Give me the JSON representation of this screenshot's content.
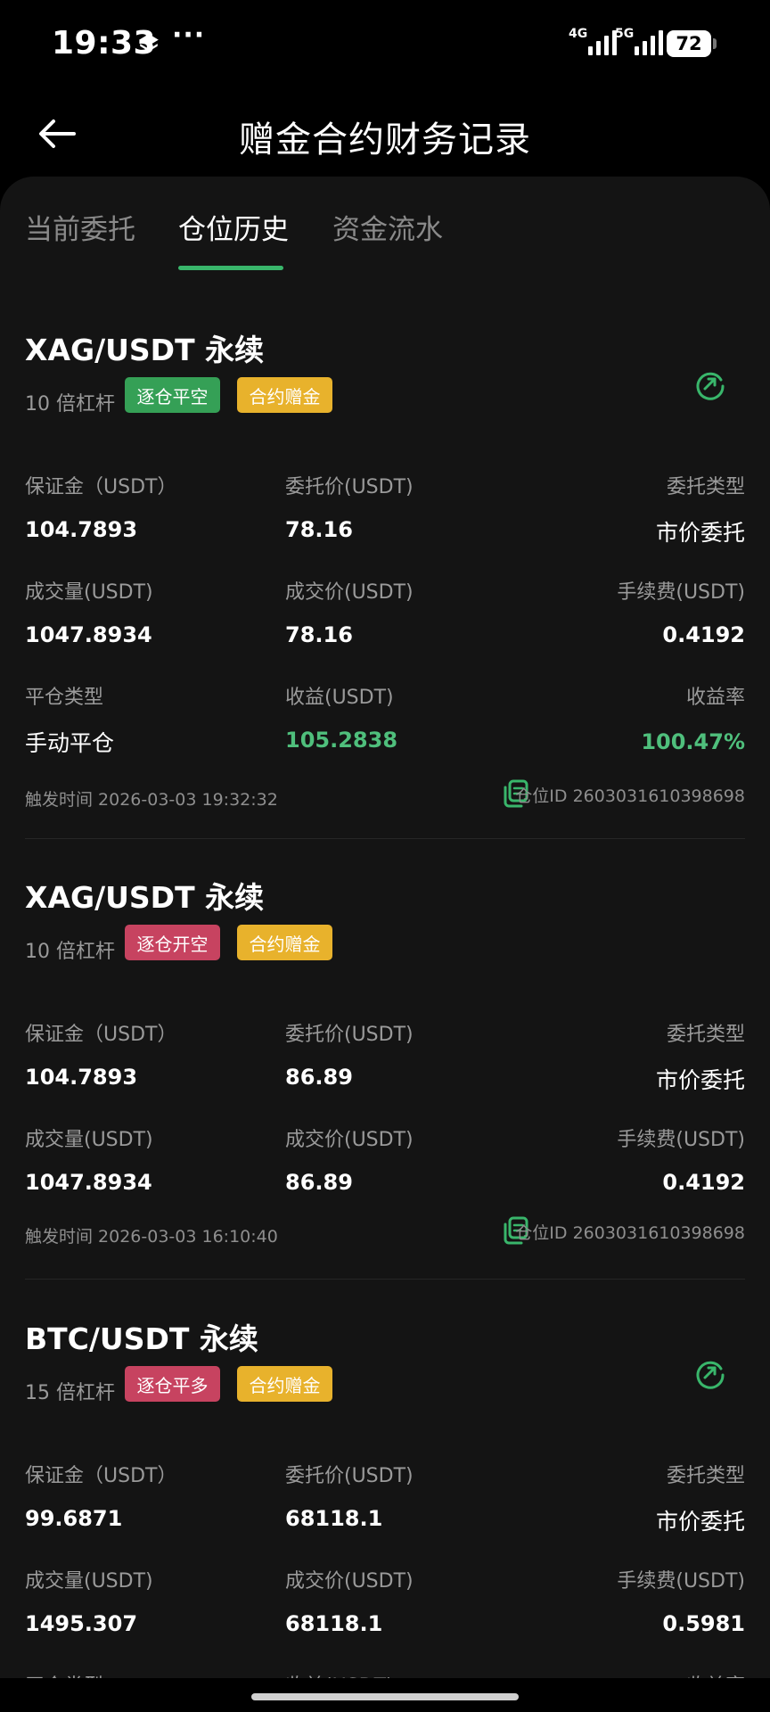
{
  "status_bar": {
    "time": "19:33",
    "dots": "···",
    "net1": "4G",
    "net2": "5G",
    "battery": "72"
  },
  "header": {
    "title": "赠金合约财务记录",
    "back_icon": "arrow-left-icon"
  },
  "tabs": [
    {
      "label": "当前委托",
      "active": false
    },
    {
      "label": "仓位历史",
      "active": true
    },
    {
      "label": "资金流水",
      "active": false
    }
  ],
  "colors": {
    "accent_green": "#39b66b",
    "tag_green": "#35a056",
    "tag_red": "#c74360",
    "tag_yellow": "#e8b22c",
    "profit_green": "#4fbf7c"
  },
  "records": [
    {
      "pair": "XAG/USDT 永续",
      "leverage": "10 倍杠杆",
      "tags": [
        {
          "label": "逐仓平空",
          "color": "green"
        },
        {
          "label": "合约赠金",
          "color": "yellow"
        }
      ],
      "fields": {
        "margin_label": "保证金（USDT）",
        "margin": "104.7893",
        "order_price_label": "委托价(USDT)",
        "order_price": "78.16",
        "order_type_label": "委托类型",
        "order_type": "市价委托",
        "volume_label": "成交量(USDT)",
        "volume": "1047.8934",
        "fill_price_label": "成交价(USDT)",
        "fill_price": "78.16",
        "fee_label": "手续费(USDT)",
        "fee": "0.4192",
        "close_type_label": "平仓类型",
        "close_type": "手动平仓",
        "pnl_label": "收益(USDT)",
        "pnl": "105.2838",
        "roi_label": "收益率",
        "roi": "100.47%"
      },
      "trigger_time": "触发时间 2026-03-03 19:32:32",
      "position_id": "仓位ID 2603031610398698"
    },
    {
      "pair": "XAG/USDT 永续",
      "leverage": "10 倍杠杆",
      "tags": [
        {
          "label": "逐仓开空",
          "color": "red"
        },
        {
          "label": "合约赠金",
          "color": "yellow"
        }
      ],
      "fields": {
        "margin_label": "保证金（USDT）",
        "margin": "104.7893",
        "order_price_label": "委托价(USDT)",
        "order_price": "86.89",
        "order_type_label": "委托类型",
        "order_type": "市价委托",
        "volume_label": "成交量(USDT)",
        "volume": "1047.8934",
        "fill_price_label": "成交价(USDT)",
        "fill_price": "86.89",
        "fee_label": "手续费(USDT)",
        "fee": "0.4192"
      },
      "trigger_time": "触发时间 2026-03-03 16:10:40",
      "position_id": "仓位ID 2603031610398698"
    },
    {
      "pair": "BTC/USDT 永续",
      "leverage": "15 倍杠杆",
      "tags": [
        {
          "label": "逐仓平多",
          "color": "red"
        },
        {
          "label": "合约赠金",
          "color": "yellow"
        }
      ],
      "fields": {
        "margin_label": "保证金（USDT）",
        "margin": "99.6871",
        "order_price_label": "委托价(USDT)",
        "order_price": "68118.1",
        "order_type_label": "委托类型",
        "order_type": "市价委托",
        "volume_label": "成交量(USDT)",
        "volume": "1495.307",
        "fill_price_label": "成交价(USDT)",
        "fill_price": "68118.1",
        "fee_label": "手续费(USDT)",
        "fee": "0.5981",
        "close_type_label": "平仓类型",
        "pnl_label": "收益(USDT)",
        "roi_label": "收益率"
      }
    }
  ]
}
